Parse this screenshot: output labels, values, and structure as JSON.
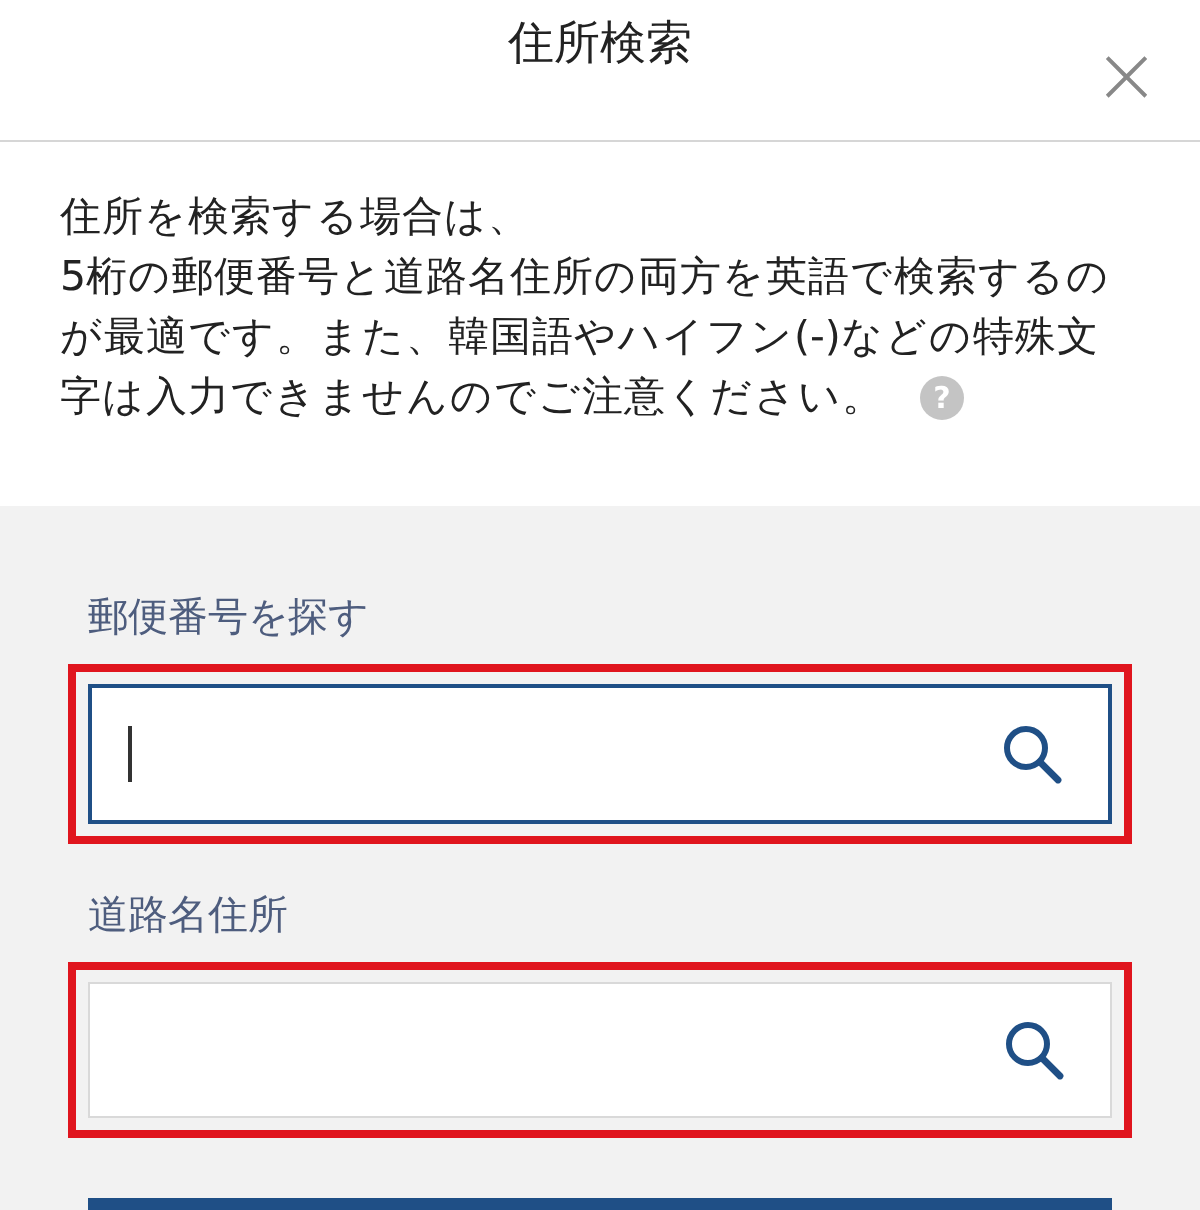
{
  "header": {
    "title": "住所検索",
    "close": "×"
  },
  "notice": {
    "text": "住所を検索する場合は、\n5桁の郵便番号と道路名住所の両方を英語で検索するのが最適です。また、韓国語やハイフン(-)などの特殊文字は入力できませんのでご注意ください。",
    "help_mark": "?"
  },
  "fields": [
    {
      "label": "郵便番号を探す",
      "focused": true,
      "highlighted": true
    },
    {
      "label": "道路名住所",
      "focused": false,
      "highlighted": true
    }
  ]
}
